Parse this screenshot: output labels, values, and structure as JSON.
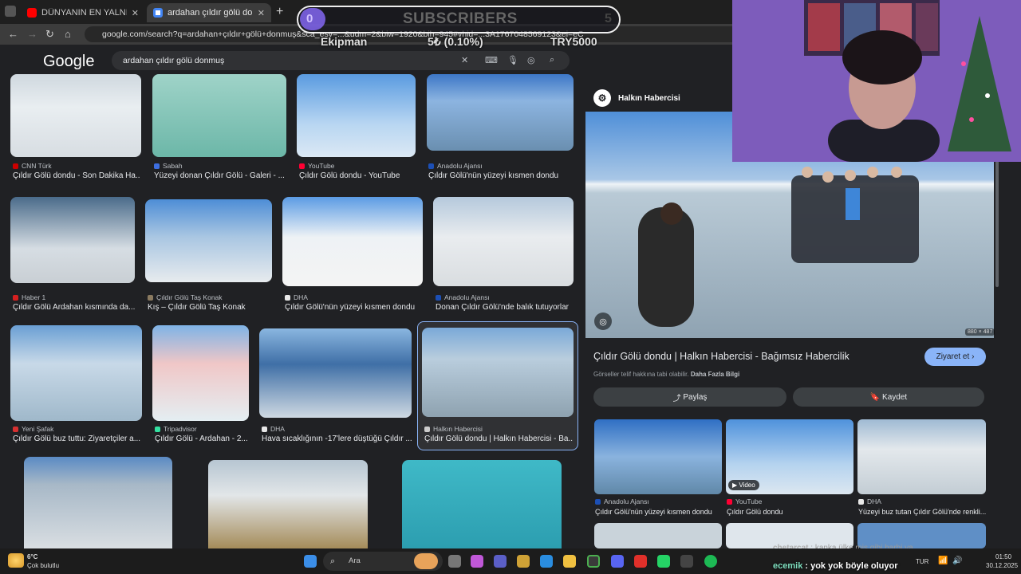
{
  "browser": {
    "tabs": [
      {
        "title": "DÜNYANIN EN YALNIZ EVİNDE",
        "favicon_color": "#ff0000"
      },
      {
        "title": "ardahan çıldır gölü donmuş - G",
        "favicon_color": "#4285f4"
      }
    ],
    "url": "google.com/search?q=ardahan+çıldır+gölü+donmuş&sca_esv=...&udm=2&biw=1920&bih=945#vhid=...3A1767048569123&ei=eC"
  },
  "google": {
    "logo": "Google",
    "query": "ardahan çıldır gölü donmuş"
  },
  "results": [
    {
      "source": "CNN Türk",
      "caption": "Çıldır Gölü dondu - Son Dakika Ha...",
      "color": "#cc0000"
    },
    {
      "source": "Sabah",
      "caption": "Yüzeyi donan Çıldır Gölü - Galeri - ...",
      "color": "#3d6ee0"
    },
    {
      "source": "YouTube",
      "caption": "Çıldır Gölü dondu - YouTube",
      "color": "#ff0033"
    },
    {
      "source": "Anadolu Ajansı",
      "caption": "Çıldır Gölü'nün yüzeyi kısmen dondu",
      "color": "#1c4fb5"
    },
    {
      "source": "Haber 1",
      "caption": "Çıldır Gölü Ardahan kısmında da...",
      "color": "#d62020"
    },
    {
      "source": "Çıldır Gölü Taş Konak",
      "caption": "Kış – Çıldır Gölü Taş Konak",
      "color": "#8a7a60"
    },
    {
      "source": "DHA",
      "caption": "Çıldır Gölü'nün yüzeyi kısmen dondu",
      "color": "#e8e8e8"
    },
    {
      "source": "Anadolu Ajansı",
      "caption": "Donan Çıldır Gölü'nde balık tutuyorlar",
      "color": "#1c4fb5"
    },
    {
      "source": "Yeni Şafak",
      "caption": "Çıldır Gölü buz tuttu: Ziyaretçiler a...",
      "color": "#d63030"
    },
    {
      "source": "Tripadvisor",
      "caption": "Çıldır Gölü - Ardahan - 2...",
      "color": "#34e0a1"
    },
    {
      "source": "DHA",
      "caption": "Hava sıcaklığının -17'lere düştüğü Çıldır ...",
      "color": "#e8e8e8"
    },
    {
      "source": "Halkın Habercisi",
      "caption": "Çıldır Gölü dondu | Halkın Habercisi - Ba...",
      "color": "#cccccc"
    }
  ],
  "panel": {
    "publisher": "Halkın Habercisi",
    "dimensions": "880 × 487",
    "title": "Çıldır Gölü dondu | Halkın Habercisi - Bağımsız Habercilik",
    "visit_label": "Ziyaret et",
    "copyright_note": "Görseller telif hakkına tabi olabilir.",
    "more_info": "Daha Fazla Bilgi",
    "share_label": "Paylaş",
    "save_label": "Kaydet",
    "related": [
      {
        "source": "Anadolu Ajansı",
        "caption": "Çıldır Gölü'nün yüzeyi kısmen dondu",
        "color": "#1c4fb5"
      },
      {
        "source": "YouTube",
        "caption": "Çıldır Gölü dondu",
        "color": "#ff0033",
        "badge": "Video"
      },
      {
        "source": "DHA",
        "caption": "Yüzeyi buz tutan Çıldır Gölü'nde renkli...",
        "color": "#e8e8e8"
      }
    ]
  },
  "stream_overlay": {
    "sub_count": "0",
    "sub_label": "SUBSCRIBERS",
    "sub_goal": "5",
    "team": "Ekipman",
    "donation": "5₺ (0.10%)",
    "goal": "TRY5000"
  },
  "chat": [
    {
      "user": "chetarcat",
      "message": "kanka ülke mis gibi harbi ya"
    },
    {
      "user": "ecemik",
      "message": "yok yok böyle oluyor"
    }
  ],
  "taskbar": {
    "weather_temp": "6°C",
    "weather_desc": "Çok bulutlu",
    "search_placeholder": "Ara",
    "lang": "TUR",
    "time": "01:50",
    "date": "30.12.2025"
  }
}
